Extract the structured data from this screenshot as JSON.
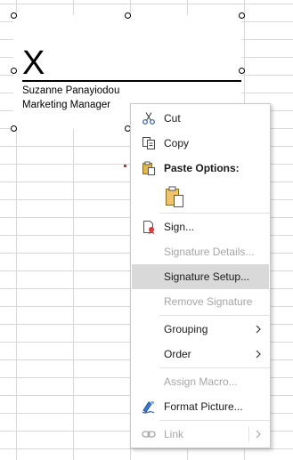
{
  "signature": {
    "mark": "X",
    "signer_name": "Suzanne Panayiodou",
    "signer_title": "Marketing Manager"
  },
  "menu": {
    "items": [
      {
        "label": "Cut",
        "icon": "scissors-icon",
        "enabled": true
      },
      {
        "label": "Copy",
        "icon": "copy-icon",
        "enabled": true
      },
      {
        "label": "Paste Options:",
        "icon": "paste-icon",
        "enabled": true
      },
      {
        "label": "Sign...",
        "icon": "sign-icon",
        "enabled": true
      },
      {
        "label": "Signature Details...",
        "enabled": false
      },
      {
        "label": "Signature Setup...",
        "enabled": true,
        "highlighted": true
      },
      {
        "label": "Remove Signature",
        "enabled": false
      },
      {
        "label": "Grouping",
        "enabled": true,
        "submenu": true
      },
      {
        "label": "Order",
        "enabled": true,
        "submenu": true
      },
      {
        "label": "Assign Macro...",
        "enabled": false
      },
      {
        "label": "Format Picture...",
        "icon": "format-picture-icon",
        "enabled": true
      },
      {
        "label": "Link",
        "icon": "link-icon",
        "enabled": false,
        "submenu": true
      }
    ]
  },
  "colors": {
    "highlight": "#d9d9d9",
    "disabled_text": "#a6a6a6",
    "icon_blue": "#2b579a",
    "icon_gold": "#c28f2c"
  }
}
